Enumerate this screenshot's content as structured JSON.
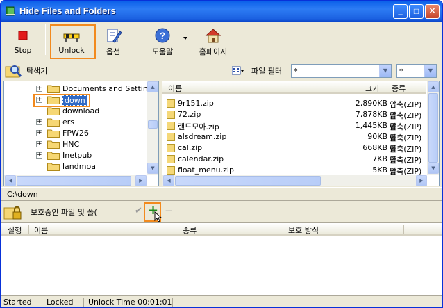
{
  "window": {
    "title": "Hide Files and Folders",
    "minimize": "_",
    "maximize": "□",
    "close": "✕"
  },
  "toolbar": {
    "stop": "Stop",
    "unlock": "Unlock",
    "options": "옵션",
    "help": "도움말",
    "homepage": "홈페이지"
  },
  "search": {
    "explorer_label": "탐색기",
    "filter_label": "파일 필터",
    "filter_value": "*",
    "filter2_value": "*"
  },
  "tree": {
    "items": [
      {
        "name": "Documents and Settings",
        "expander": "+"
      },
      {
        "name": "down",
        "expander": "+"
      },
      {
        "name": "download",
        "expander": ""
      },
      {
        "name": "ers",
        "expander": "+"
      },
      {
        "name": "FPW26",
        "expander": "+"
      },
      {
        "name": "HNC",
        "expander": "+"
      },
      {
        "name": "Inetpub",
        "expander": "+"
      },
      {
        "name": "landmoa",
        "expander": ""
      }
    ]
  },
  "files": {
    "columns": {
      "name": "이름",
      "size": "크기",
      "type": "종류"
    },
    "rows": [
      {
        "name": "9r151.zip",
        "size": "2,890KB",
        "type": "압축(ZIP) 폴"
      },
      {
        "name": "72.zip",
        "size": "7,878KB",
        "type": "압축(ZIP) 폴"
      },
      {
        "name": "랜드모아.zip",
        "size": "1,445KB",
        "type": "압축(ZIP) 폴"
      },
      {
        "name": "alsdream.zip",
        "size": "90KB",
        "type": "압축(ZIP) 폴"
      },
      {
        "name": "cal.zip",
        "size": "668KB",
        "type": "압축(ZIP) 폴"
      },
      {
        "name": "calendar.zip",
        "size": "7KB",
        "type": "압축(ZIP) 폴"
      },
      {
        "name": "float_menu.zip",
        "size": "5KB",
        "type": "압축(ZIP) 폴"
      }
    ]
  },
  "path": "C:\\down",
  "protected": {
    "label": "보호중인 파일 및 폴(",
    "check": "✔",
    "add": "+",
    "remove": "−",
    "columns": {
      "run": "실행",
      "name": "이름",
      "type": "종류",
      "protection": "보호 방식"
    }
  },
  "status": {
    "state": "Started",
    "lock": "Locked",
    "unlock_time": "Unlock Time 00:01:01"
  }
}
